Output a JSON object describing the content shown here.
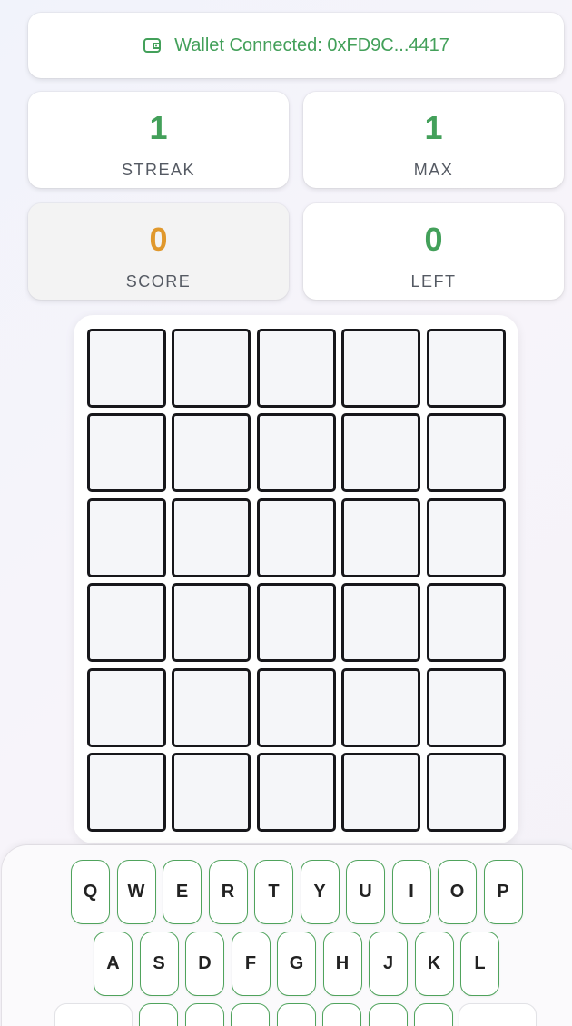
{
  "wallet": {
    "icon": "wallet-icon",
    "text": "Wallet Connected: 0xFD9C...4417",
    "color": "#43a05a"
  },
  "stats": [
    {
      "value": "1",
      "label": "STREAK",
      "color": "#43a05a"
    },
    {
      "value": "1",
      "label": "MAX",
      "color": "#43a05a"
    },
    {
      "value": "0",
      "label": "SCORE",
      "color": "#e0982c"
    },
    {
      "value": "0",
      "label": "LEFT",
      "color": "#43a05a"
    }
  ],
  "board": {
    "rows": [
      [
        "",
        "",
        "",
        "",
        ""
      ],
      [
        "",
        "",
        "",
        "",
        ""
      ],
      [
        "",
        "",
        "",
        "",
        ""
      ],
      [
        "",
        "",
        "",
        "",
        ""
      ],
      [
        "",
        "",
        "",
        "",
        ""
      ],
      [
        "",
        "",
        "",
        "",
        ""
      ]
    ]
  },
  "keyboard": {
    "row1": [
      "Q",
      "W",
      "E",
      "R",
      "T",
      "Y",
      "U",
      "I",
      "O",
      "P"
    ],
    "row2": [
      "A",
      "S",
      "D",
      "F",
      "G",
      "H",
      "J",
      "K",
      "L"
    ],
    "row3": [
      "",
      "",
      "",
      "",
      "",
      "",
      "",
      "",
      ""
    ]
  },
  "colors": {
    "accent_green": "#43a05a",
    "accent_orange": "#e0982c",
    "cell_border": "#17171b",
    "cell_fill": "#f5f6f9"
  }
}
